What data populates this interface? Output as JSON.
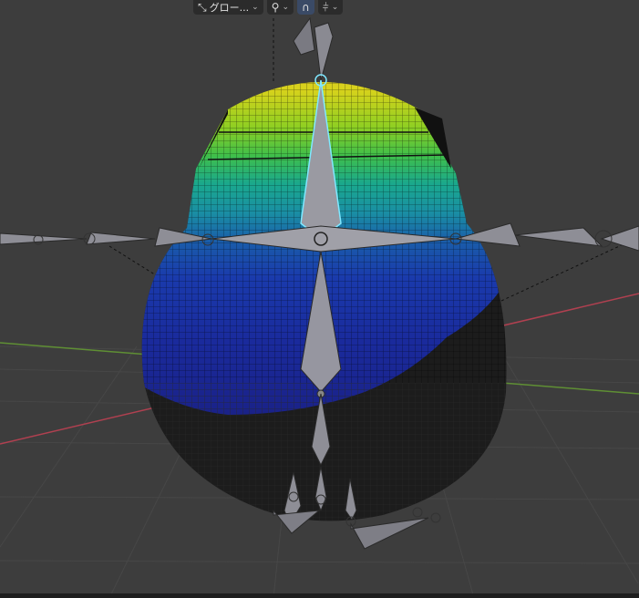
{
  "header": {
    "transform_orientation": {
      "label": "グロー...",
      "icon": "transform-orientation-icon"
    },
    "pivot": {
      "icon": "pivot-point-icon"
    },
    "snap": {
      "icon": "snap-magnet-icon",
      "active": true
    },
    "snap_target": {
      "icon": "snap-increment-icon"
    }
  },
  "viewport": {
    "object": "weight-painted-mesh-with-armature",
    "colors": {
      "background": "#3d3d3d",
      "grid": "#454545",
      "x_axis": "#c04858",
      "y_axis": "#6a9a3a",
      "bone": "#8d8d96",
      "bone_selected": "#7fe8ff",
      "weight_high": "#d8c81c",
      "weight_mid": "#1fa98e",
      "weight_low": "#1a2aa8",
      "weight_zero": "#1c1c1c"
    }
  }
}
